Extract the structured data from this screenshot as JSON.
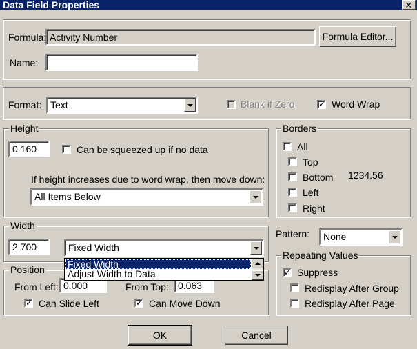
{
  "window": {
    "title": "Data Field Properties"
  },
  "top": {
    "formula_label": "Formula:",
    "formula_value": "Activity Number",
    "formula_editor_button": "Formula Editor...",
    "name_label": "Name:",
    "name_value": ""
  },
  "format": {
    "label": "Format:",
    "value": "Text",
    "blank_if_zero_label": "Blank if Zero",
    "blank_if_zero_checked": false,
    "word_wrap_label": "Word Wrap",
    "word_wrap_checked": true
  },
  "height": {
    "legend": "Height",
    "value": "0.160",
    "squeeze_label": "Can be squeezed up if no data",
    "squeeze_checked": false,
    "move_down_label": "If height increases due to word wrap, then move down:",
    "move_down_value": "All Items Below"
  },
  "borders": {
    "legend": "Borders",
    "all_label": "All",
    "top_label": "Top",
    "bottom_label": "Bottom",
    "left_label": "Left",
    "right_label": "Right",
    "sample": "1234.56"
  },
  "width": {
    "legend": "Width",
    "value": "2.700",
    "mode_value": "Fixed Width",
    "options": [
      "Fixed Width",
      "Adjust Width to Data"
    ]
  },
  "pattern": {
    "label": "Pattern:",
    "value": "None"
  },
  "position": {
    "legend": "Position",
    "from_left_label": "From Left:",
    "from_left_value": "0.000",
    "from_top_label": "From Top:",
    "from_top_value": "0.063",
    "slide_left_label": "Can Slide Left",
    "slide_left_checked": true,
    "move_down_label": "Can Move Down",
    "move_down_checked": true
  },
  "repeating": {
    "legend": "Repeating Values",
    "suppress_label": "Suppress",
    "suppress_checked": true,
    "after_group_label": "Redisplay After Group",
    "after_page_label": "Redisplay After Page"
  },
  "buttons": {
    "ok": "OK",
    "cancel": "Cancel"
  }
}
